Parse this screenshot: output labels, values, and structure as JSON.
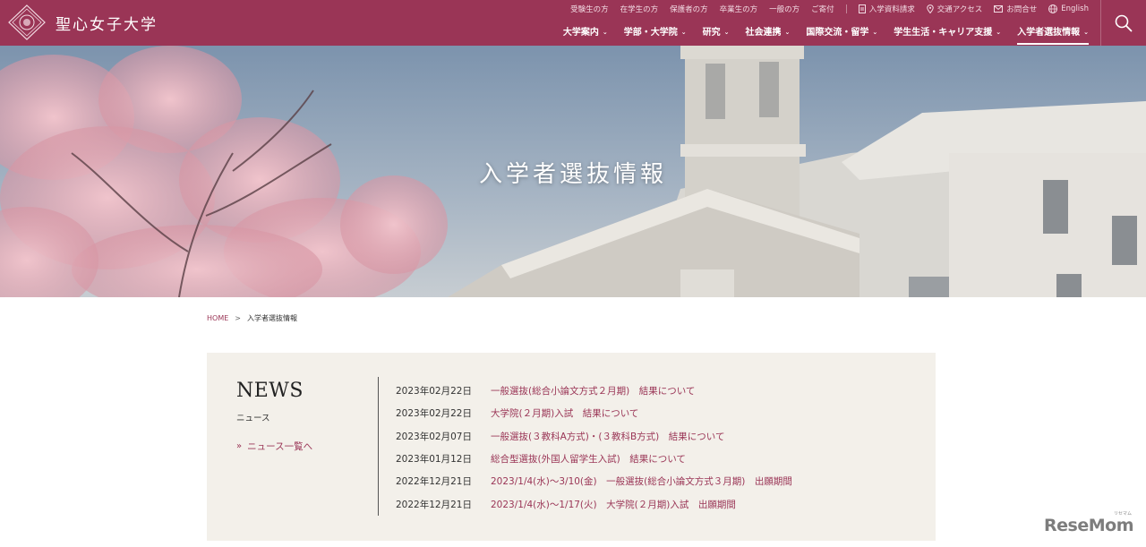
{
  "header": {
    "logo_text": "聖心女子大学",
    "util_links": [
      "受験生の方",
      "在学生の方",
      "保護者の方",
      "卒業生の方",
      "一般の方",
      "ご寄付"
    ],
    "util_icon_links": [
      {
        "label": "入学資料請求",
        "icon": "document-icon"
      },
      {
        "label": "交通アクセス",
        "icon": "map-pin-icon"
      },
      {
        "label": "お問合せ",
        "icon": "mail-icon"
      },
      {
        "label": "English",
        "icon": "globe-icon"
      }
    ],
    "main_nav": [
      {
        "label": "大学案内"
      },
      {
        "label": "学部・大学院"
      },
      {
        "label": "研究"
      },
      {
        "label": "社会連携"
      },
      {
        "label": "国際交流・留学"
      },
      {
        "label": "学生生活・キャリア支援"
      },
      {
        "label": "入学者選抜情報",
        "active": true
      }
    ],
    "chevron": "⌄"
  },
  "hero": {
    "title": "入学者選抜情報"
  },
  "breadcrumb": {
    "home": "HOME",
    "separator": ">",
    "current": "入学者選抜情報"
  },
  "news": {
    "title": "NEWS",
    "subtitle": "ニュース",
    "all_link": "ニュース一覧へ",
    "all_link_chevron": "»",
    "items": [
      {
        "date": "2023年02月22日",
        "text": "一般選抜(総合小論文方式２月期)　結果について"
      },
      {
        "date": "2023年02月22日",
        "text": "大学院(２月期)入試　結果について"
      },
      {
        "date": "2023年02月07日",
        "text": "一般選抜(３教科A方式)・(３教科B方式)　結果について"
      },
      {
        "date": "2023年01月12日",
        "text": "総合型選抜(外国人留学生入試)　結果について"
      },
      {
        "date": "2022年12月21日",
        "text": "2023/1/4(水)～3/10(金)　一般選抜(総合小論文方式３月期)　出願期間"
      },
      {
        "date": "2022年12月21日",
        "text": "2023/1/4(水)～1/17(火)　大学院(２月期)入試　出願期間"
      }
    ]
  },
  "watermark": {
    "text": "ReseMom",
    "small": "リセマム"
  },
  "colors": {
    "brand": "#9a3556",
    "news_bg": "#f3f0ea",
    "link": "#9a3556"
  }
}
